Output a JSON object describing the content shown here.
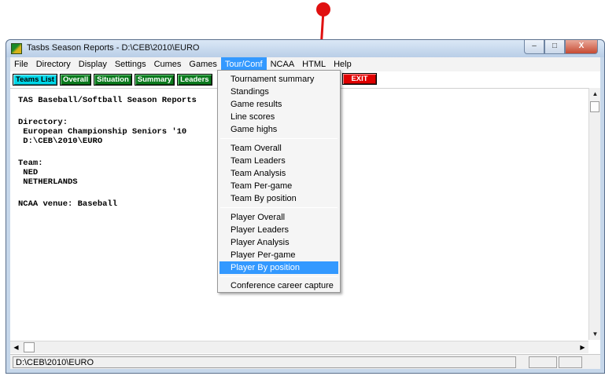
{
  "window": {
    "title": "Tasbs Season Reports - D:\\CEB\\2010\\EURO",
    "controls": {
      "minimize": "–",
      "maximize": "□",
      "close": "X"
    }
  },
  "menubar": [
    "File",
    "Directory",
    "Display",
    "Settings",
    "Cumes",
    "Games",
    "Tour/Conf",
    "NCAA",
    "HTML",
    "Help"
  ],
  "active_menu": "Tour/Conf",
  "toolbar": {
    "teams_list": "Teams List",
    "overall": "Overall",
    "situation": "Situation",
    "summary": "Summary",
    "leaders": "Leaders",
    "exit": "EXIT"
  },
  "content_lines": [
    "TAS Baseball/Softball Season Reports",
    "",
    "Directory:",
    " European Championship Seniors '10",
    " D:\\CEB\\2010\\EURO",
    "",
    "Team:",
    " NED",
    " NETHERLANDS",
    "",
    "NCAA venue: Baseball"
  ],
  "dropdown": {
    "group1": [
      "Tournament summary",
      "Standings",
      "Game results",
      "Line scores",
      "Game highs"
    ],
    "group2": [
      "Team Overall",
      "Team Leaders",
      "Team Analysis",
      "Team Per-game",
      "Team By position"
    ],
    "group3": [
      "Player Overall",
      "Player Leaders",
      "Player Analysis",
      "Player Per-game",
      "Player By position"
    ],
    "group4": [
      "Conference career capture"
    ],
    "highlighted": "Player By position"
  },
  "status": {
    "path": "D:\\CEB\\2010\\EURO"
  },
  "colors": {
    "annotation": "#e01010",
    "menu_highlight": "#3399ff",
    "button_green": "#0b7a1e",
    "button_cyan": "#00d7e8",
    "button_red": "#e00000"
  },
  "icons": [
    "app-logo-icon",
    "minimize-icon",
    "maximize-icon",
    "close-icon",
    "scroll-up-icon",
    "scroll-down-icon",
    "scroll-left-icon",
    "scroll-right-icon"
  ]
}
